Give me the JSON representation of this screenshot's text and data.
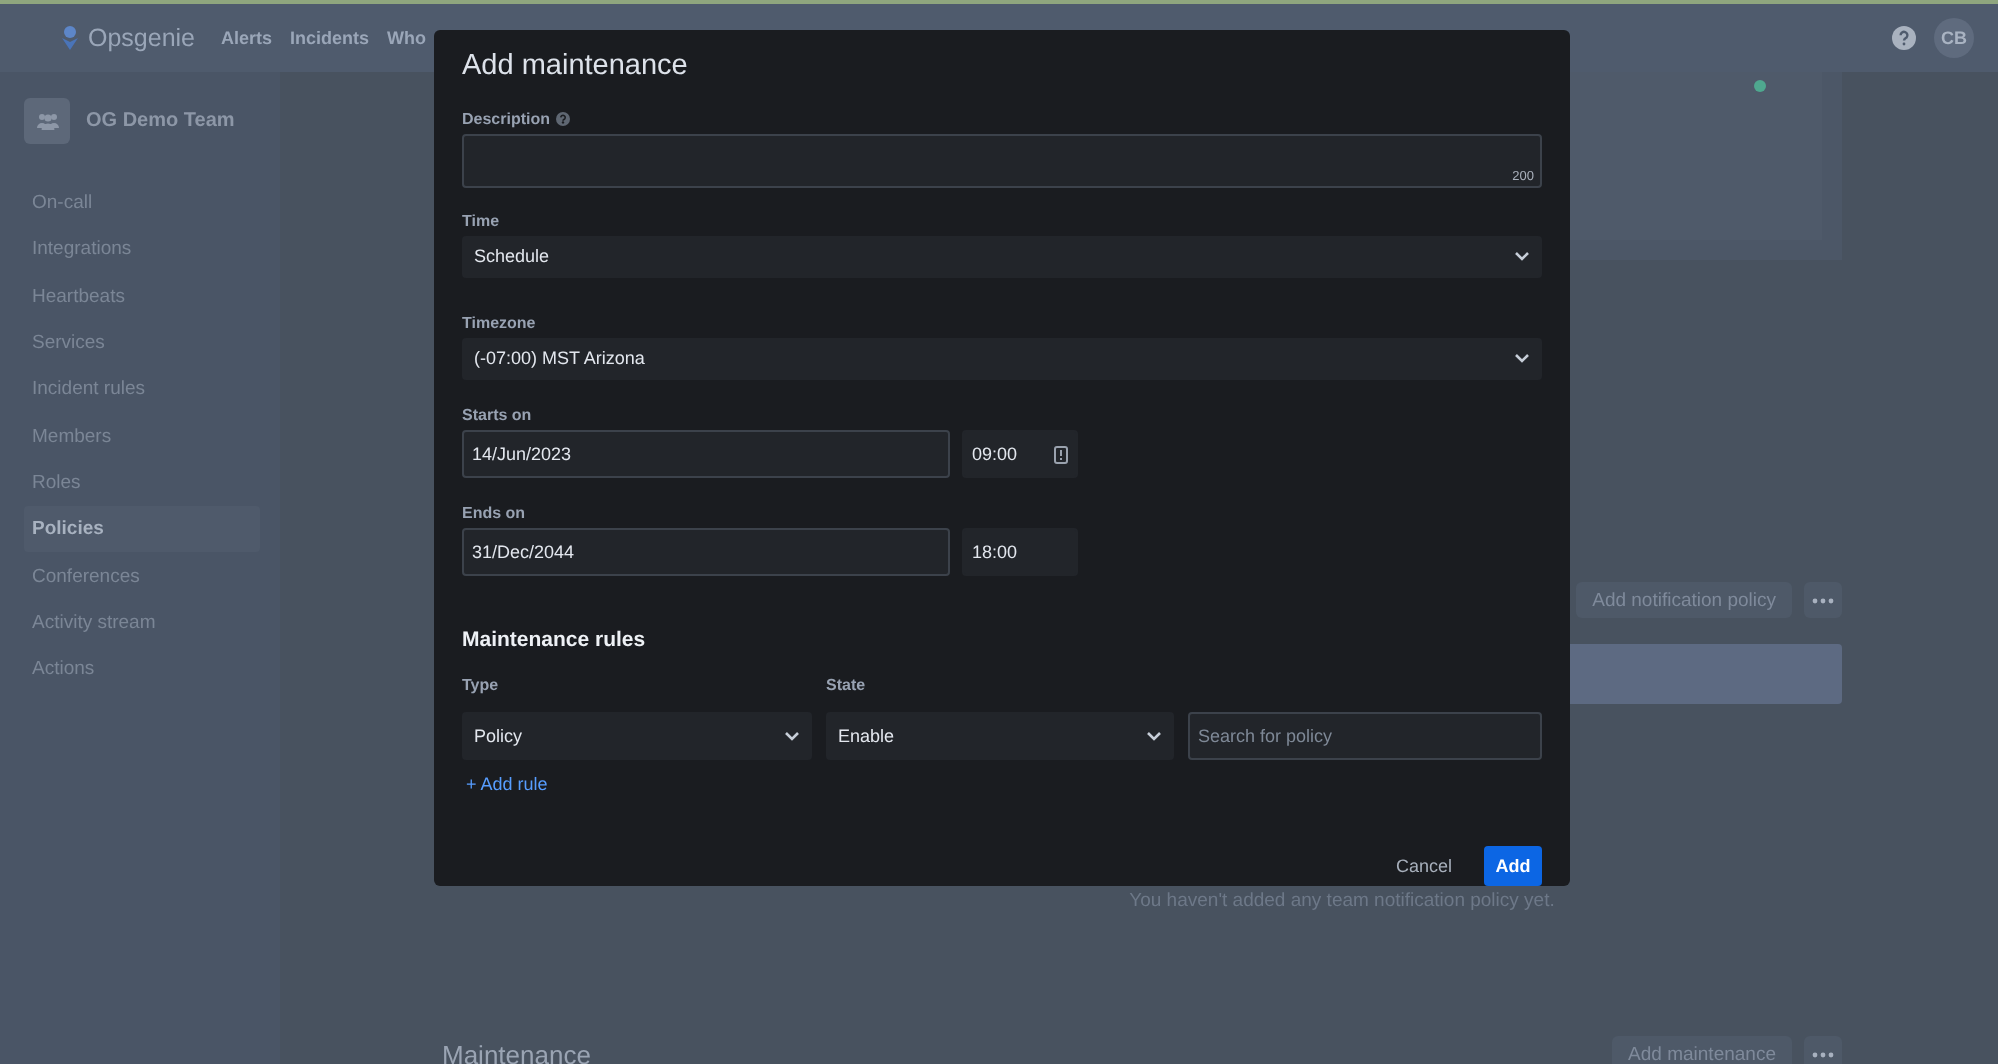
{
  "topbar": {
    "brand": "Opsgenie",
    "nav": [
      {
        "label": "Alerts"
      },
      {
        "label": "Incidents"
      },
      {
        "label": "Who"
      }
    ],
    "avatar": "CB"
  },
  "sidebar": {
    "team": "OG Demo Team",
    "items": [
      {
        "label": "On-call",
        "selected": false
      },
      {
        "label": "Integrations",
        "selected": false
      },
      {
        "label": "Heartbeats",
        "selected": false
      },
      {
        "label": "Services",
        "selected": false
      },
      {
        "label": "Incident rules",
        "selected": false
      },
      {
        "label": "Members",
        "selected": false
      },
      {
        "label": "Roles",
        "selected": false
      },
      {
        "label": "Policies",
        "selected": true
      },
      {
        "label": "Conferences",
        "selected": false
      },
      {
        "label": "Activity stream",
        "selected": false
      },
      {
        "label": "Actions",
        "selected": false
      }
    ]
  },
  "main": {
    "status_dot": {
      "color": "#4fa88f"
    },
    "notification_button": "Add notification policy",
    "empty_text": "You haven't added any team notification policy yet.",
    "maintenance_title": "Maintenance",
    "maintenance_button": "Add maintenance"
  },
  "dialog": {
    "title": "Add maintenance",
    "description": {
      "label": "Description",
      "counter": "200"
    },
    "time": {
      "label": "Time",
      "value": "Schedule"
    },
    "timezone": {
      "label": "Timezone",
      "value": "(-07:00) MST Arizona"
    },
    "starts": {
      "label": "Starts on",
      "date": "14/Jun/2023",
      "time": "09:00"
    },
    "ends": {
      "label": "Ends on",
      "date": "31/Dec/2044",
      "time": "18:00"
    },
    "rules": {
      "title": "Maintenance rules",
      "type_label": "Type",
      "state_label": "State",
      "type": "Policy",
      "state": "Enable",
      "search_placeholder": "Search for policy",
      "add_rule": "+ Add rule"
    },
    "buttons": {
      "cancel": "Cancel",
      "add": "Add"
    }
  }
}
